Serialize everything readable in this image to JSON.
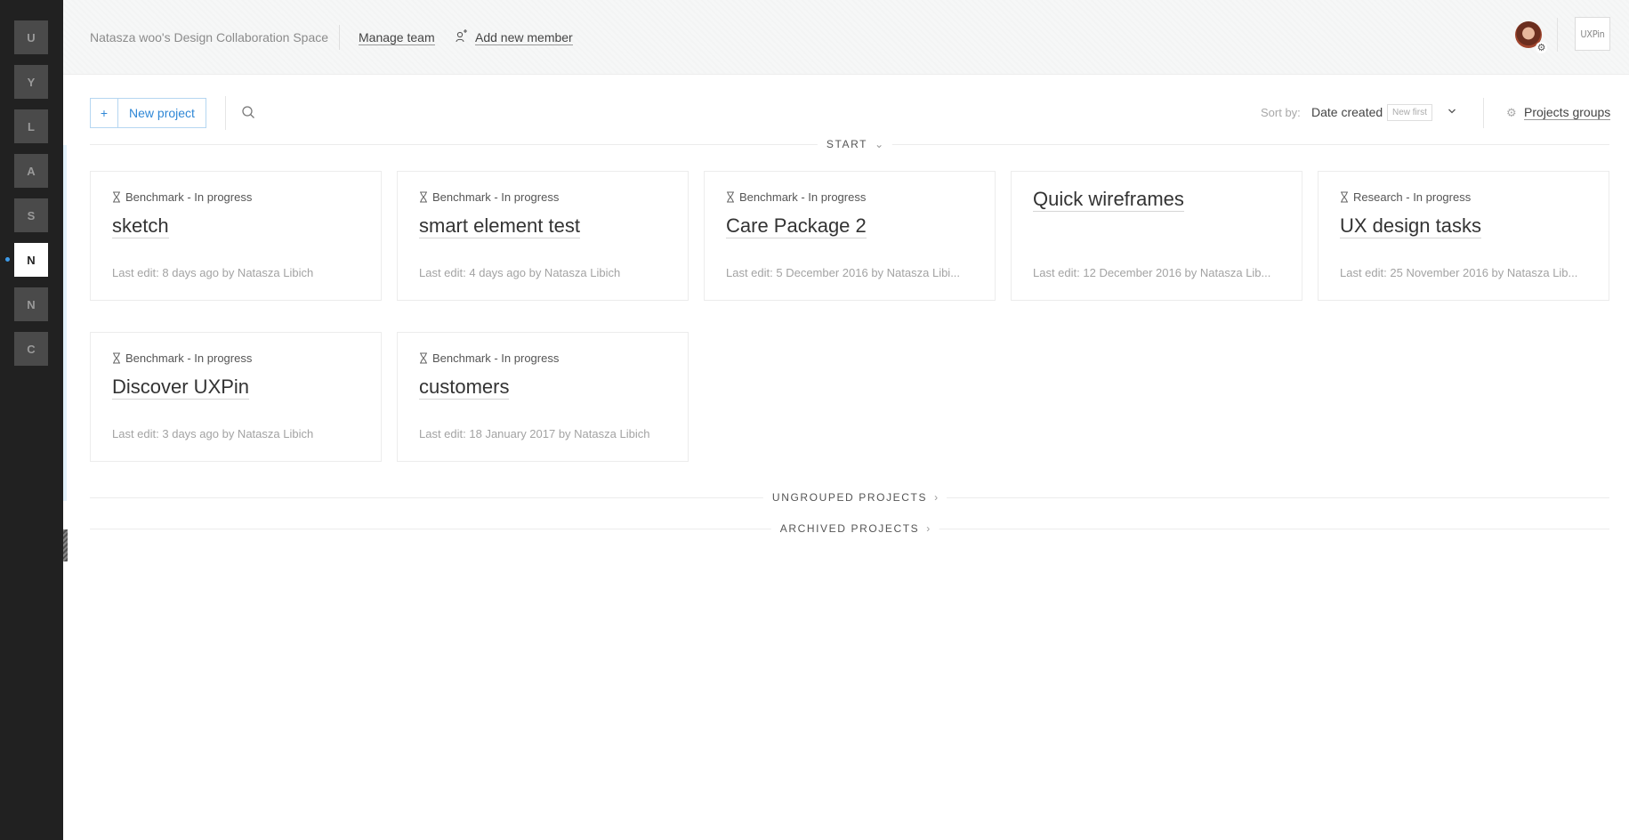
{
  "workspaces": {
    "items": [
      {
        "letter": "U"
      },
      {
        "letter": "Y"
      },
      {
        "letter": "L"
      },
      {
        "letter": "A"
      },
      {
        "letter": "S"
      },
      {
        "letter": "N",
        "active": true
      },
      {
        "letter": "N"
      },
      {
        "letter": "C"
      }
    ]
  },
  "header": {
    "space_name": "Natasza woo's Design Collaboration Space",
    "manage_team": "Manage team",
    "add_member": "Add new member",
    "logo_text": "UXPin"
  },
  "toolbar": {
    "new_project_plus": "+",
    "new_project_label": "New project",
    "sort_label": "Sort by:",
    "sort_value": "Date created",
    "sort_order": "New first",
    "groups_link": "Projects groups"
  },
  "groups": {
    "start": "START",
    "ungrouped": "UNGROUPED PROJECTS",
    "archived": "ARCHIVED PROJECTS"
  },
  "projects": [
    {
      "status": "Benchmark - In progress",
      "title": "sketch",
      "last_edit": "Last edit: 8 days ago by Natasza Libich"
    },
    {
      "status": "Benchmark - In progress",
      "title": "smart element test",
      "last_edit": "Last edit: 4 days ago by Natasza Libich"
    },
    {
      "status": "Benchmark - In progress",
      "title": "Care Package 2",
      "last_edit": "Last edit: 5 December 2016 by Natasza Libi..."
    },
    {
      "status": "",
      "title": "Quick wireframes",
      "last_edit": "Last edit: 12 December 2016 by Natasza Lib..."
    },
    {
      "status": "Research - In progress",
      "title": "UX design tasks",
      "last_edit": "Last edit: 25 November 2016 by Natasza Lib..."
    },
    {
      "status": "Benchmark - In progress",
      "title": "Discover UXPin",
      "last_edit": "Last edit: 3 days ago by Natasza Libich"
    },
    {
      "status": "Benchmark - In progress",
      "title": "customers",
      "last_edit": "Last edit: 18 January 2017 by Natasza Libich"
    }
  ],
  "icons": {
    "status": "hourglass-icon",
    "search": "search-icon",
    "add_member": "add-person-icon",
    "settings": "gear-icon",
    "chevron": "chevron-down-icon"
  },
  "colors": {
    "rail_bg": "#212121",
    "accent": "#2f87d6",
    "active_dot": "#3d9be9"
  }
}
